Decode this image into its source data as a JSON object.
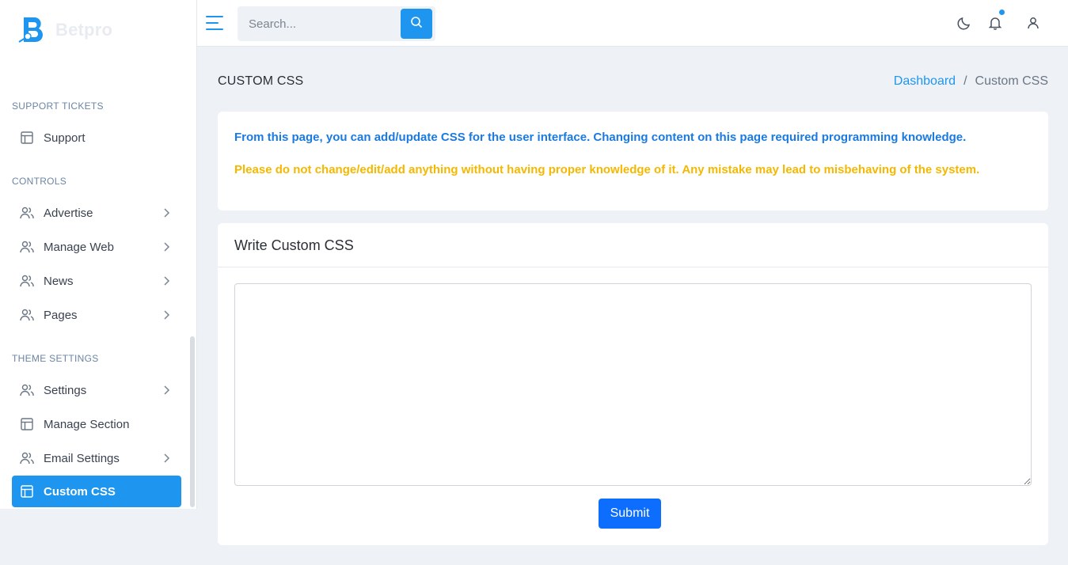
{
  "brand": {
    "name": "Betpro",
    "accent": "#1e96f0"
  },
  "sidebar": {
    "sections": [
      {
        "title": "SUPPORT TICKETS",
        "items": [
          {
            "label": "Support",
            "icon": "layout-icon",
            "has_submenu": false,
            "active": false
          }
        ]
      },
      {
        "title": "CONTROLS",
        "items": [
          {
            "label": "Advertise",
            "icon": "users-icon",
            "has_submenu": true,
            "active": false
          },
          {
            "label": "Manage Web",
            "icon": "users-icon",
            "has_submenu": true,
            "active": false
          },
          {
            "label": "News",
            "icon": "users-icon",
            "has_submenu": true,
            "active": false
          },
          {
            "label": "Pages",
            "icon": "users-icon",
            "has_submenu": true,
            "active": false
          }
        ]
      },
      {
        "title": "THEME SETTINGS",
        "items": [
          {
            "label": "Settings",
            "icon": "users-icon",
            "has_submenu": true,
            "active": false
          },
          {
            "label": "Manage Section",
            "icon": "layout-icon",
            "has_submenu": false,
            "active": false
          },
          {
            "label": "Email Settings",
            "icon": "users-icon",
            "has_submenu": true,
            "active": false
          },
          {
            "label": "Custom CSS",
            "icon": "layout-icon",
            "has_submenu": false,
            "active": true
          }
        ]
      }
    ]
  },
  "topbar": {
    "search": {
      "placeholder": "Search..."
    }
  },
  "page": {
    "title": "CUSTOM CSS",
    "breadcrumb": {
      "home": "Dashboard",
      "separator": "/",
      "current": "Custom CSS"
    }
  },
  "notice": {
    "info": "From this page, you can add/update CSS for the user interface. Changing content on this page required programming knowledge.",
    "warning": "Please do not change/edit/add anything without having proper knowledge of it. Any mistake may lead to misbehaving of the system.",
    "info_color": "#1a7ae0",
    "warning_color": "#f5b800"
  },
  "editor": {
    "title": "Write Custom CSS",
    "value": "",
    "submit_label": "Submit"
  }
}
